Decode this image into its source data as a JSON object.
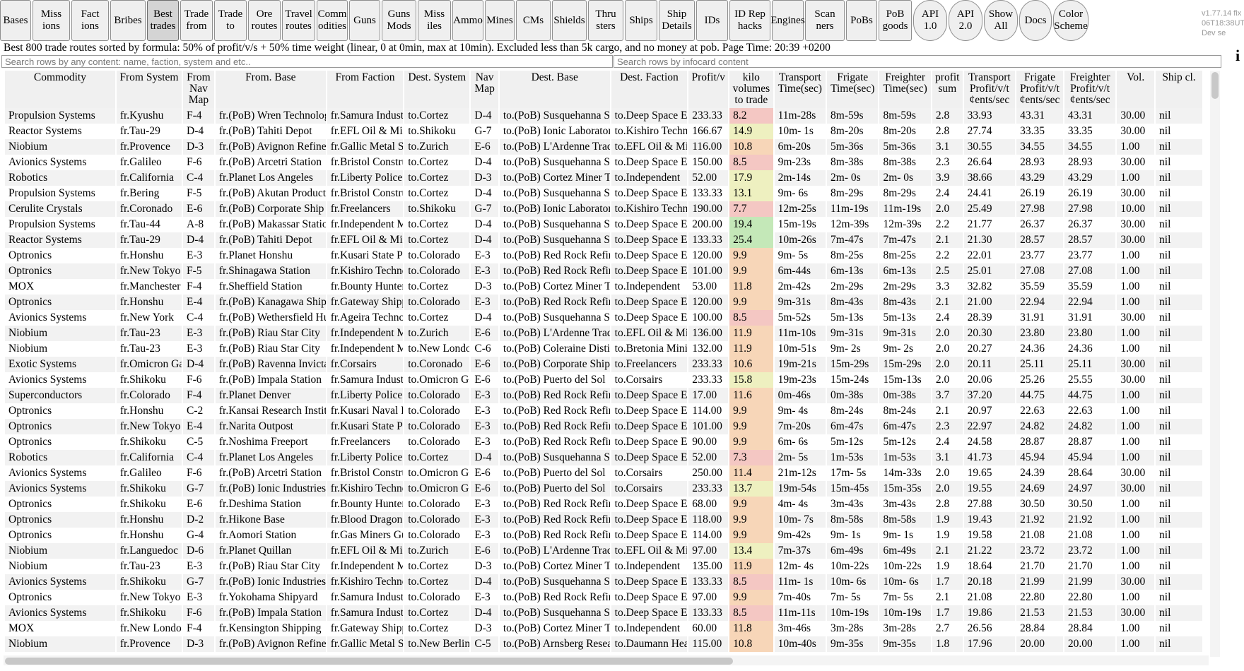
{
  "nav": [
    {
      "label": "Bases",
      "active": false,
      "round": false
    },
    {
      "label": "Miss ions",
      "active": false,
      "round": false
    },
    {
      "label": "Fact ions",
      "active": false,
      "round": false
    },
    {
      "label": "Bribes",
      "active": false,
      "round": false
    },
    {
      "label": "Best trades",
      "active": true,
      "round": false
    },
    {
      "label": "Trade from",
      "active": false,
      "round": false
    },
    {
      "label": "Trade to",
      "active": false,
      "round": false
    },
    {
      "label": "Ore routes",
      "active": false,
      "round": false
    },
    {
      "label": "Travel routes",
      "active": false,
      "round": false
    },
    {
      "label": "Comm odities",
      "active": false,
      "round": false
    },
    {
      "label": "Guns",
      "active": false,
      "round": false
    },
    {
      "label": "Guns Mods",
      "active": false,
      "round": false
    },
    {
      "label": "Miss iles",
      "active": false,
      "round": false
    },
    {
      "label": "Ammo",
      "active": false,
      "round": false
    },
    {
      "label": "Mines",
      "active": false,
      "round": false
    },
    {
      "label": "CMs",
      "active": false,
      "round": false
    },
    {
      "label": "Shields",
      "active": false,
      "round": false
    },
    {
      "label": "Thru sters",
      "active": false,
      "round": false
    },
    {
      "label": "Ships",
      "active": false,
      "round": false
    },
    {
      "label": "Ship Details",
      "active": false,
      "round": false
    },
    {
      "label": "IDs",
      "active": false,
      "round": false
    },
    {
      "label": "ID Rep hacks",
      "active": false,
      "round": false
    },
    {
      "label": "Engines",
      "active": false,
      "round": false
    },
    {
      "label": "Scan ners",
      "active": false,
      "round": false
    },
    {
      "label": "PoBs",
      "active": false,
      "round": false
    },
    {
      "label": "PoB goods",
      "active": false,
      "round": false
    },
    {
      "label": "API 1.0",
      "active": false,
      "round": true
    },
    {
      "label": "API 2.0",
      "active": false,
      "round": true
    },
    {
      "label": "Show All",
      "active": false,
      "round": true
    },
    {
      "label": "Docs",
      "active": false,
      "round": true
    },
    {
      "label": "Color Scheme",
      "active": false,
      "round": true
    }
  ],
  "version": {
    "line1": "v1.77.14 fix",
    "line2": "06T18:38UT",
    "line3": "Dev se"
  },
  "info_icon": "i",
  "status_text": "Best 800 trade routes sorted by formula: 50% of profit/v/s + 50% time weight (linear, 0 at 0min, max at 10min). Excluded less than 5k cargo, and no money at pob. Page Time: 20:39 +0200",
  "search": {
    "rows_placeholder": "Search rows by any content: name, faction, system and etc..",
    "infocards_placeholder": "Search rows by infocard content"
  },
  "colors": {
    "vol_red": "#f4c7c3",
    "vol_orange": "#f7d6b8",
    "vol_yellow": "#eef0c0",
    "vol_green": "#c4e8b8"
  },
  "columns": [
    "Commodity",
    "From System",
    "From Nav Map",
    "From. Base",
    "From Faction",
    "Dest. System",
    "Nav Map",
    "Dest. Base",
    "Dest. Faction",
    "Profit/v",
    "kilo volumes to trade",
    "Transport Time(sec)",
    "Frigate Time(sec)",
    "Freighter Time(sec)",
    "profit sum",
    "Transport Profit/v/t ¢ents/sec",
    "Frigate Profit/v/t ¢ents/sec",
    "Freighter Profit/v/t ¢ents/sec",
    "Vol.",
    "Ship cl."
  ],
  "rows": [
    [
      "Propulsion Systems",
      "fr.Kyushu",
      "F-4",
      "fr.(PoB) Wren Technologies",
      "fr.Samura Industries",
      "to.Cortez",
      "D-4",
      "to.(PoB) Susquehanna Station",
      "to.Deep Space Engineering",
      "233.33",
      "8.2",
      "11m-28s",
      "8m-59s",
      "8m-59s",
      "2.8",
      "33.93",
      "43.31",
      "43.31",
      "30.00",
      "nil"
    ],
    [
      "Reactor Systems",
      "fr.Tau-29",
      "D-4",
      "fr.(PoB) Tahiti Depot",
      "fr.EFL Oil & Minerals",
      "to.Shikoku",
      "G-7",
      "to.(PoB) Ionic Laboratory",
      "to.Kishiro Technologies",
      "166.67",
      "14.9",
      "10m- 1s",
      "8m-20s",
      "8m-20s",
      "2.8",
      "27.74",
      "33.35",
      "33.35",
      "30.00",
      "nil"
    ],
    [
      "Niobium",
      "fr.Provence",
      "D-3",
      "fr.(PoB) Avignon Refinery",
      "fr.Gallic Metal Smelting",
      "to.Zurich",
      "E-6",
      "to.(PoB) L'Ardenne Trading",
      "to.EFL Oil & Minerals",
      "116.00",
      "10.8",
      "6m-20s",
      "5m-36s",
      "5m-36s",
      "3.1",
      "30.55",
      "34.55",
      "34.55",
      "1.00",
      "nil"
    ],
    [
      "Avionics Systems",
      "fr.Galileo",
      "F-6",
      "fr.(PoB) Arcetri Station",
      "fr.Bristol Construction",
      "to.Cortez",
      "D-4",
      "to.(PoB) Susquehanna Station",
      "to.Deep Space Engineering",
      "150.00",
      "8.5",
      "9m-23s",
      "8m-38s",
      "8m-38s",
      "2.3",
      "26.64",
      "28.93",
      "28.93",
      "30.00",
      "nil"
    ],
    [
      "Robotics",
      "fr.California",
      "C-4",
      "fr.Planet Los Angeles",
      "fr.Liberty Police",
      "to.Cortez",
      "D-3",
      "to.(PoB) Cortez Miner Tower",
      "to.Independent",
      "52.00",
      "17.9",
      "2m-14s",
      "2m- 0s",
      "2m- 0s",
      "3.9",
      "38.66",
      "43.29",
      "43.29",
      "1.00",
      "nil"
    ],
    [
      "Propulsion Systems",
      "fr.Bering",
      "F-5",
      "fr.(PoB) Akutan Production",
      "fr.Bristol Construction",
      "to.Cortez",
      "D-4",
      "to.(PoB) Susquehanna Station",
      "to.Deep Space Engineering",
      "133.33",
      "13.1",
      "9m- 6s",
      "8m-29s",
      "8m-29s",
      "2.4",
      "24.41",
      "26.19",
      "26.19",
      "30.00",
      "nil"
    ],
    [
      "Cerulite Crystals",
      "fr.Coronado",
      "E-6",
      "fr.(PoB) Corporate Ship",
      "fr.Freelancers",
      "to.Shikoku",
      "G-7",
      "to.(PoB) Ionic Laboratory",
      "to.Kishiro Technologies",
      "190.00",
      "7.7",
      "12m-25s",
      "11m-19s",
      "11m-19s",
      "2.0",
      "25.49",
      "27.98",
      "27.98",
      "10.00",
      "nil"
    ],
    [
      "Propulsion Systems",
      "fr.Tau-44",
      "A-8",
      "fr.(PoB) Makassar Station",
      "fr.Independent Miners",
      "to.Cortez",
      "D-4",
      "to.(PoB) Susquehanna Station",
      "to.Deep Space Engineering",
      "200.00",
      "19.4",
      "15m-19s",
      "12m-39s",
      "12m-39s",
      "2.2",
      "21.77",
      "26.37",
      "26.37",
      "30.00",
      "nil"
    ],
    [
      "Reactor Systems",
      "fr.Tau-29",
      "D-4",
      "fr.(PoB) Tahiti Depot",
      "fr.EFL Oil & Minerals",
      "to.Cortez",
      "D-4",
      "to.(PoB) Susquehanna Station",
      "to.Deep Space Engineering",
      "133.33",
      "25.4",
      "10m-26s",
      "7m-47s",
      "7m-47s",
      "2.1",
      "21.30",
      "28.57",
      "28.57",
      "30.00",
      "nil"
    ],
    [
      "Optronics",
      "fr.Honshu",
      "E-3",
      "fr.Planet Honshu",
      "fr.Kusari State Police",
      "to.Colorado",
      "E-3",
      "to.(PoB) Red Rock Refinery",
      "to.Deep Space Engineering",
      "120.00",
      "9.9",
      "9m- 5s",
      "8m-25s",
      "8m-25s",
      "2.2",
      "22.01",
      "23.77",
      "23.77",
      "1.00",
      "nil"
    ],
    [
      "Optronics",
      "fr.New Tokyo",
      "F-5",
      "fr.Shinagawa Station",
      "fr.Kishiro Technologies",
      "to.Colorado",
      "E-3",
      "to.(PoB) Red Rock Refinery",
      "to.Deep Space Engineering",
      "101.00",
      "9.9",
      "6m-44s",
      "6m-13s",
      "6m-13s",
      "2.5",
      "25.01",
      "27.08",
      "27.08",
      "1.00",
      "nil"
    ],
    [
      "MOX",
      "fr.Manchester",
      "F-4",
      "fr.Sheffield Station",
      "fr.Bounty Hunters Guild",
      "to.Cortez",
      "D-3",
      "to.(PoB) Cortez Miner Tower",
      "to.Independent",
      "53.00",
      "11.8",
      "2m-42s",
      "2m-29s",
      "2m-29s",
      "3.3",
      "32.82",
      "35.59",
      "35.59",
      "1.00",
      "nil"
    ],
    [
      "Optronics",
      "fr.Honshu",
      "E-4",
      "fr.(PoB) Kanagawa Shipyard",
      "fr.Gateway Shipping",
      "to.Colorado",
      "E-3",
      "to.(PoB) Red Rock Refinery",
      "to.Deep Space Engineering",
      "120.00",
      "9.9",
      "9m-31s",
      "8m-43s",
      "8m-43s",
      "2.1",
      "21.00",
      "22.94",
      "22.94",
      "1.00",
      "nil"
    ],
    [
      "Avionics Systems",
      "fr.New York",
      "C-4",
      "fr.(PoB) Wethersfield Hub",
      "fr.Ageira Technologies",
      "to.Cortez",
      "D-4",
      "to.(PoB) Susquehanna Station",
      "to.Deep Space Engineering",
      "100.00",
      "8.5",
      "5m-52s",
      "5m-13s",
      "5m-13s",
      "2.4",
      "28.39",
      "31.91",
      "31.91",
      "30.00",
      "nil"
    ],
    [
      "Niobium",
      "fr.Tau-23",
      "E-3",
      "fr.(PoB) Riau Star City",
      "fr.Independent Miners",
      "to.Zurich",
      "E-6",
      "to.(PoB) L'Ardenne Trading",
      "to.EFL Oil & Minerals",
      "136.00",
      "11.9",
      "11m-10s",
      "9m-31s",
      "9m-31s",
      "2.0",
      "20.30",
      "23.80",
      "23.80",
      "1.00",
      "nil"
    ],
    [
      "Niobium",
      "fr.Tau-23",
      "E-3",
      "fr.(PoB) Riau Star City",
      "fr.Independent Miners",
      "to.New London",
      "C-6",
      "to.(PoB) Coleraine Distillery",
      "to.Bretonia Mining",
      "132.00",
      "11.9",
      "10m-51s",
      "9m- 2s",
      "9m- 2s",
      "2.0",
      "20.27",
      "24.36",
      "24.36",
      "1.00",
      "nil"
    ],
    [
      "Exotic Systems",
      "fr.Omicron Gamma",
      "D-4",
      "fr.(PoB) Ravenna Invicta",
      "fr.Corsairs",
      "to.Coronado",
      "E-6",
      "to.(PoB) Corporate Ship",
      "to.Freelancers",
      "233.33",
      "10.6",
      "19m-21s",
      "15m-29s",
      "15m-29s",
      "2.0",
      "20.11",
      "25.11",
      "25.11",
      "30.00",
      "nil"
    ],
    [
      "Avionics Systems",
      "fr.Shikoku",
      "F-6",
      "fr.(PoB) Impala Station",
      "fr.Samura Industries",
      "to.Omicron Gamma",
      "E-6",
      "to.(PoB) Puerto del Sol",
      "to.Corsairs",
      "233.33",
      "15.8",
      "19m-23s",
      "15m-24s",
      "15m-13s",
      "2.0",
      "20.06",
      "25.26",
      "25.55",
      "30.00",
      "nil"
    ],
    [
      "Superconductors",
      "fr.Colorado",
      "F-4",
      "fr.Planet Denver",
      "fr.Liberty Police",
      "to.Colorado",
      "E-3",
      "to.(PoB) Red Rock Refinery",
      "to.Deep Space Engineering",
      "17.00",
      "11.6",
      "0m-46s",
      "0m-38s",
      "0m-38s",
      "3.7",
      "37.20",
      "44.75",
      "44.75",
      "1.00",
      "nil"
    ],
    [
      "Optronics",
      "fr.Honshu",
      "C-2",
      "fr.Kansai Research Institute",
      "fr.Kusari Naval Forces",
      "to.Colorado",
      "E-3",
      "to.(PoB) Red Rock Refinery",
      "to.Deep Space Engineering",
      "114.00",
      "9.9",
      "9m- 4s",
      "8m-24s",
      "8m-24s",
      "2.1",
      "20.97",
      "22.63",
      "22.63",
      "1.00",
      "nil"
    ],
    [
      "Optronics",
      "fr.New Tokyo",
      "E-4",
      "fr.Narita Outpost",
      "fr.Kusari State Police",
      "to.Colorado",
      "E-3",
      "to.(PoB) Red Rock Refinery",
      "to.Deep Space Engineering",
      "101.00",
      "9.9",
      "7m-20s",
      "6m-47s",
      "6m-47s",
      "2.3",
      "22.97",
      "24.82",
      "24.82",
      "1.00",
      "nil"
    ],
    [
      "Optronics",
      "fr.Shikoku",
      "C-5",
      "fr.Noshima Freeport",
      "fr.Freelancers",
      "to.Colorado",
      "E-3",
      "to.(PoB) Red Rock Refinery",
      "to.Deep Space Engineering",
      "90.00",
      "9.9",
      "6m- 6s",
      "5m-12s",
      "5m-12s",
      "2.4",
      "24.58",
      "28.87",
      "28.87",
      "1.00",
      "nil"
    ],
    [
      "Robotics",
      "fr.California",
      "C-4",
      "fr.Planet Los Angeles",
      "fr.Liberty Police",
      "to.Cortez",
      "D-4",
      "to.(PoB) Susquehanna Station",
      "to.Deep Space Engineering",
      "52.00",
      "7.3",
      "2m- 5s",
      "1m-53s",
      "1m-53s",
      "3.1",
      "41.73",
      "45.94",
      "45.94",
      "1.00",
      "nil"
    ],
    [
      "Avionics Systems",
      "fr.Galileo",
      "F-6",
      "fr.(PoB) Arcetri Station",
      "fr.Bristol Construction",
      "to.Omicron Gamma",
      "E-6",
      "to.(PoB) Puerto del Sol",
      "to.Corsairs",
      "250.00",
      "11.4",
      "21m-12s",
      "17m- 5s",
      "14m-33s",
      "2.0",
      "19.65",
      "24.39",
      "28.64",
      "30.00",
      "nil"
    ],
    [
      "Avionics Systems",
      "fr.Shikoku",
      "G-7",
      "fr.(PoB) Ionic Industries",
      "fr.Kishiro Technologies",
      "to.Omicron Gamma",
      "E-6",
      "to.(PoB) Puerto del Sol",
      "to.Corsairs",
      "233.33",
      "13.7",
      "19m-54s",
      "15m-45s",
      "15m-35s",
      "2.0",
      "19.55",
      "24.69",
      "24.97",
      "30.00",
      "nil"
    ],
    [
      "Optronics",
      "fr.Shikoku",
      "E-6",
      "fr.Deshima Station",
      "fr.Bounty Hunters Guild",
      "to.Colorado",
      "E-3",
      "to.(PoB) Red Rock Refinery",
      "to.Deep Space Engineering",
      "68.00",
      "9.9",
      "4m- 4s",
      "3m-43s",
      "3m-43s",
      "2.8",
      "27.88",
      "30.50",
      "30.50",
      "1.00",
      "nil"
    ],
    [
      "Optronics",
      "fr.Honshu",
      "D-2",
      "fr.Hikone Base",
      "fr.Blood Dragons",
      "to.Colorado",
      "E-3",
      "to.(PoB) Red Rock Refinery",
      "to.Deep Space Engineering",
      "118.00",
      "9.9",
      "10m- 7s",
      "8m-58s",
      "8m-58s",
      "1.9",
      "19.43",
      "21.92",
      "21.92",
      "1.00",
      "nil"
    ],
    [
      "Optronics",
      "fr.Honshu",
      "G-4",
      "fr.Aomori Station",
      "fr.Gas Miners Guild",
      "to.Colorado",
      "E-3",
      "to.(PoB) Red Rock Refinery",
      "to.Deep Space Engineering",
      "114.00",
      "9.9",
      "9m-42s",
      "9m- 1s",
      "9m- 1s",
      "1.9",
      "19.58",
      "21.08",
      "21.08",
      "1.00",
      "nil"
    ],
    [
      "Niobium",
      "fr.Languedoc",
      "D-6",
      "fr.Planet Quillan",
      "fr.EFL Oil & Minerals",
      "to.Zurich",
      "E-6",
      "to.(PoB) L'Ardenne Trading",
      "to.EFL Oil & Minerals",
      "97.00",
      "13.4",
      "7m-37s",
      "6m-49s",
      "6m-49s",
      "2.1",
      "21.22",
      "23.72",
      "23.72",
      "1.00",
      "nil"
    ],
    [
      "Niobium",
      "fr.Tau-23",
      "E-3",
      "fr.(PoB) Riau Star City",
      "fr.Independent Miners",
      "to.Cortez",
      "D-3",
      "to.(PoB) Cortez Miner Tower",
      "to.Independent",
      "135.00",
      "11.9",
      "12m- 4s",
      "10m-22s",
      "10m-22s",
      "1.9",
      "18.64",
      "21.70",
      "21.70",
      "1.00",
      "nil"
    ],
    [
      "Avionics Systems",
      "fr.Shikoku",
      "G-7",
      "fr.(PoB) Ionic Industries",
      "fr.Kishiro Technologies",
      "to.Cortez",
      "D-4",
      "to.(PoB) Susquehanna Station",
      "to.Deep Space Engineering",
      "133.33",
      "8.5",
      "11m- 1s",
      "10m- 6s",
      "10m- 6s",
      "1.7",
      "20.18",
      "21.99",
      "21.99",
      "30.00",
      "nil"
    ],
    [
      "Optronics",
      "fr.New Tokyo",
      "E-3",
      "fr.Yokohama Shipyard",
      "fr.Samura Industries",
      "to.Colorado",
      "E-3",
      "to.(PoB) Red Rock Refinery",
      "to.Deep Space Engineering",
      "97.00",
      "9.9",
      "7m-40s",
      "7m- 5s",
      "7m- 5s",
      "2.1",
      "21.08",
      "22.80",
      "22.80",
      "1.00",
      "nil"
    ],
    [
      "Avionics Systems",
      "fr.Shikoku",
      "F-6",
      "fr.(PoB) Impala Station",
      "fr.Samura Industries",
      "to.Cortez",
      "D-4",
      "to.(PoB) Susquehanna Station",
      "to.Deep Space Engineering",
      "133.33",
      "8.5",
      "11m-11s",
      "10m-19s",
      "10m-19s",
      "1.7",
      "19.86",
      "21.53",
      "21.53",
      "30.00",
      "nil"
    ],
    [
      "MOX",
      "fr.New London",
      "F-4",
      "fr.Kensington Shipping",
      "fr.Gateway Shipping",
      "to.Cortez",
      "D-3",
      "to.(PoB) Cortez Miner Tower",
      "to.Independent",
      "60.00",
      "11.8",
      "3m-46s",
      "3m-28s",
      "3m-28s",
      "2.7",
      "26.56",
      "28.84",
      "28.84",
      "1.00",
      "nil"
    ],
    [
      "Niobium",
      "fr.Provence",
      "D-3",
      "fr.(PoB) Avignon Refinery",
      "fr.Gallic Metal Smelting",
      "to.New Berlin",
      "C-5",
      "to.(PoB) Arnsberg Research",
      "to.Daumann Heavy",
      "115.00",
      "10.8",
      "10m-40s",
      "9m-35s",
      "9m-35s",
      "1.8",
      "17.96",
      "20.00",
      "20.00",
      "1.00",
      "nil"
    ]
  ]
}
